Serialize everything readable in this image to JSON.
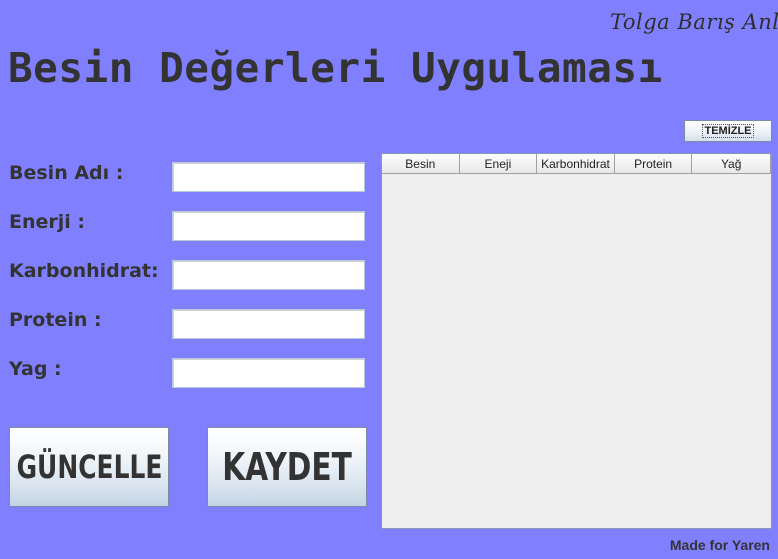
{
  "author": "Tolga Barış Anlı",
  "title": "Besin Değerleri Uygulaması",
  "form": {
    "fields": [
      {
        "label": "Besin Adı :",
        "value": ""
      },
      {
        "label": "Enerji :",
        "value": ""
      },
      {
        "label": "Karbonhidrat:",
        "value": ""
      },
      {
        "label": "Protein :",
        "value": ""
      },
      {
        "label": "Yag :",
        "value": ""
      }
    ]
  },
  "buttons": {
    "update_label": "GÜNCELLE",
    "save_label": "KAYDET",
    "clear_label": "TEMİZLE"
  },
  "table": {
    "columns": [
      "Besin",
      "Eneji",
      "Karbonhidrat",
      "Protein",
      "Yağ"
    ],
    "rows": []
  },
  "footer": "Made for Yaren"
}
